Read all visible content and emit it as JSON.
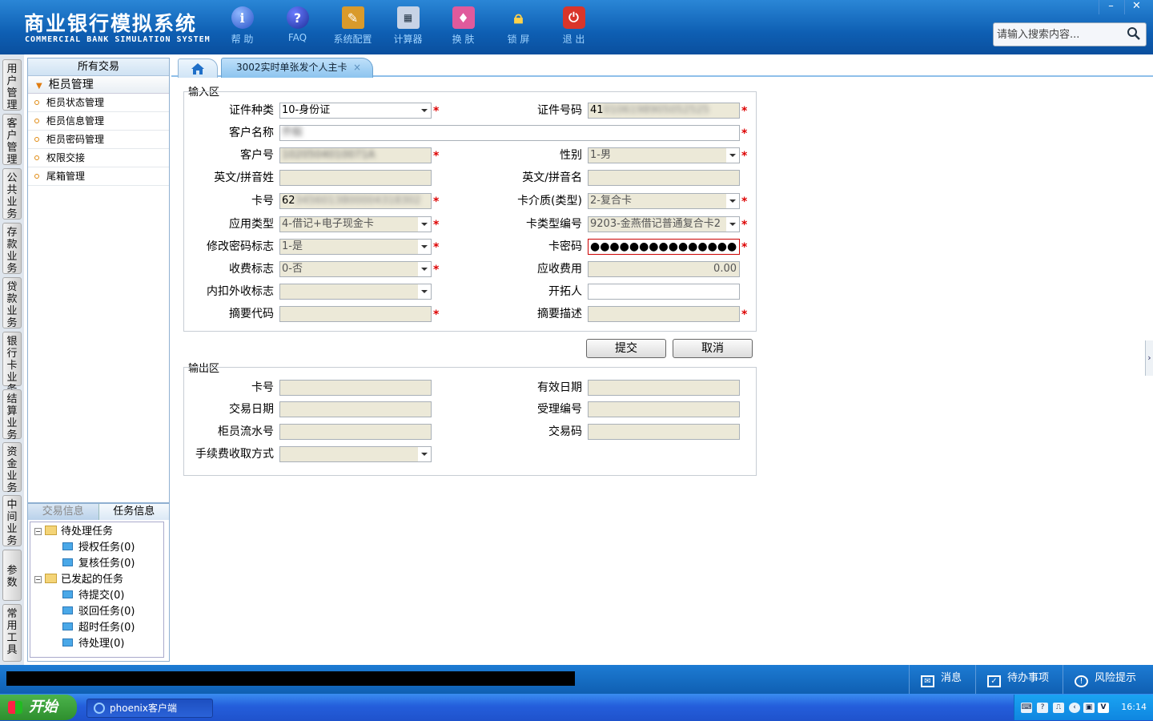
{
  "app": {
    "title": "商业银行模拟系统",
    "subtitle": "COMMERCIAL BANK SIMULATION SYSTEM"
  },
  "toolbar": [
    {
      "label": "帮 助",
      "icon": "info-icon"
    },
    {
      "label": "FAQ",
      "icon": "faq-icon"
    },
    {
      "label": "系统配置",
      "icon": "config-icon"
    },
    {
      "label": "计算器",
      "icon": "calculator-icon"
    },
    {
      "label": "换 肤",
      "icon": "skin-icon"
    },
    {
      "label": "锁 屏",
      "icon": "lock-icon"
    },
    {
      "label": "退 出",
      "icon": "exit-icon"
    }
  ],
  "window_buttons": {
    "minimize": "–",
    "close": "✕"
  },
  "search": {
    "placeholder": "请输入搜索内容..."
  },
  "module_tabs": [
    "用户管理",
    "客户管理",
    "公共业务",
    "存款业务",
    "贷款业务",
    "银行卡业务",
    "结算业务",
    "资金业务",
    "中间业务",
    "参数",
    "常用工具"
  ],
  "menu": {
    "header": "所有交易",
    "group": "柜员管理",
    "items": [
      "柜员状态管理",
      "柜员信息管理",
      "柜员密码管理",
      "权限交接",
      "尾箱管理"
    ]
  },
  "task_panel": {
    "tabs": [
      "交易信息",
      "任务信息"
    ],
    "tree": [
      {
        "label": "待处理任务",
        "level": 0
      },
      {
        "label": "授权任务(0)",
        "level": 1
      },
      {
        "label": "复核任务(0)",
        "level": 1
      },
      {
        "label": "已发起的任务",
        "level": 0
      },
      {
        "label": "待提交(0)",
        "level": 1
      },
      {
        "label": "驳回任务(0)",
        "level": 1
      },
      {
        "label": "超时任务(0)",
        "level": 1
      },
      {
        "label": "待处理(0)",
        "level": 1
      }
    ]
  },
  "tabs": {
    "active": "3002实时单张发个人主卡",
    "close": "×"
  },
  "input_section": {
    "title": "输入区",
    "fields": {
      "id_type": {
        "label": "证件种类",
        "value": "10-身份证"
      },
      "id_number": {
        "label": "证件号码",
        "value": "41",
        "blurred": "0106198905052525"
      },
      "customer_name": {
        "label": "客户名称",
        "blurred": "乔毅"
      },
      "customer_no": {
        "label": "客户号",
        "blurred": "1020504010071A"
      },
      "gender": {
        "label": "性别",
        "value": "1-男"
      },
      "en_surname": {
        "label": "英文/拼音姓",
        "value": ""
      },
      "en_name": {
        "label": "英文/拼音名",
        "value": ""
      },
      "card_no": {
        "label": "卡号",
        "value": "62",
        "blurred": "3456013800004318302"
      },
      "card_medium": {
        "label": "卡介质(类型)",
        "value": "2-复合卡"
      },
      "app_type": {
        "label": "应用类型",
        "value": "4-借记+电子现金卡"
      },
      "card_type_code": {
        "label": "卡类型编号",
        "value": "9203-金燕借记普通复合卡2"
      },
      "change_pwd_flag": {
        "label": "修改密码标志",
        "value": "1-是"
      },
      "card_pwd": {
        "label": "卡密码",
        "value": "●●●●●●●●●●●●●●●"
      },
      "fee_flag": {
        "label": "收费标志",
        "value": "0-否"
      },
      "fee_due": {
        "label": "应收费用",
        "value": "0.00"
      },
      "deduct_flag": {
        "label": "内扣外收标志",
        "value": ""
      },
      "developer": {
        "label": "开拓人",
        "value": ""
      },
      "summary_code": {
        "label": "摘要代码",
        "value": ""
      },
      "summary_desc": {
        "label": "摘要描述",
        "value": ""
      }
    },
    "required_mark": "*"
  },
  "buttons": {
    "submit": "提交",
    "cancel": "取消"
  },
  "output_section": {
    "title": "输出区",
    "fields": {
      "card_no": {
        "label": "卡号",
        "value": ""
      },
      "expiry": {
        "label": "有效日期",
        "value": ""
      },
      "trans_date": {
        "label": "交易日期",
        "value": ""
      },
      "accept_no": {
        "label": "受理编号",
        "value": ""
      },
      "teller_seq": {
        "label": "柜员流水号",
        "value": ""
      },
      "trans_code": {
        "label": "交易码",
        "value": ""
      },
      "fee_method": {
        "label": "手续费收取方式",
        "value": ""
      }
    }
  },
  "statusbar": {
    "message": "消息",
    "todo": "待办事项",
    "risk": "风险提示"
  },
  "taskbar": {
    "start": "开始",
    "app": "phoenix客户端",
    "clock": "16:14"
  }
}
